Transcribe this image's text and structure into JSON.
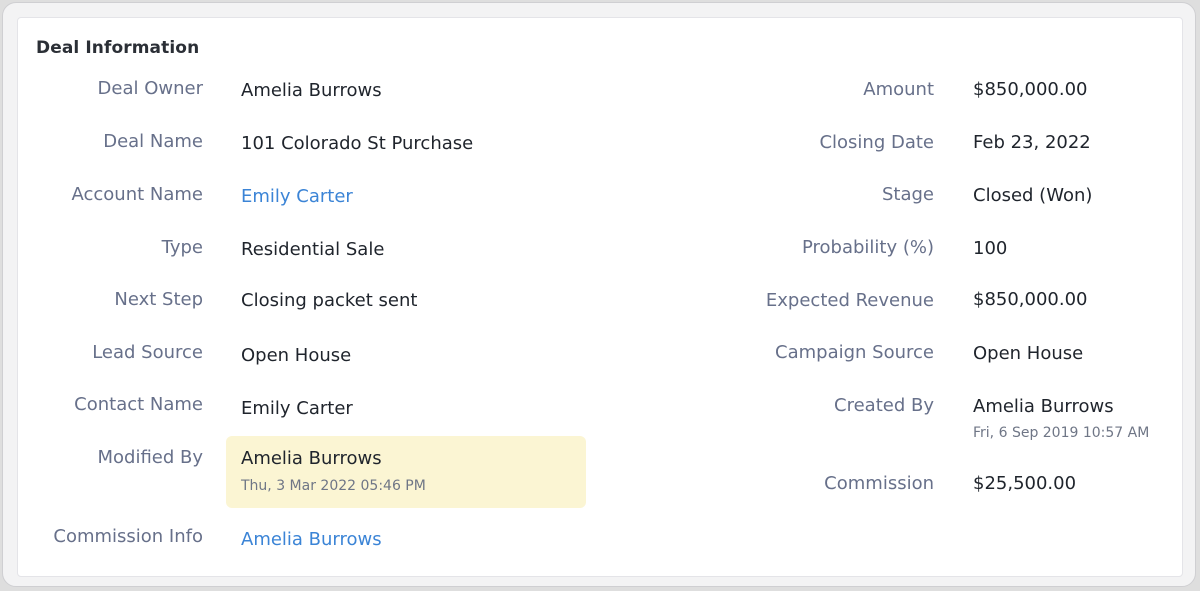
{
  "section": {
    "title": "Deal Information"
  },
  "left_fields": [
    {
      "label": "Deal Owner",
      "value": "Amelia Burrows"
    },
    {
      "label": "Deal Name",
      "value": "101 Colorado St Purchase"
    },
    {
      "label": "Account Name",
      "value": "Emily Carter"
    },
    {
      "label": "Type",
      "value": "Residential Sale"
    },
    {
      "label": "Next Step",
      "value": "Closing packet sent"
    },
    {
      "label": "Lead Source",
      "value": "Open House"
    },
    {
      "label": "Contact Name",
      "value": "Emily Carter"
    },
    {
      "label": "Modified By",
      "value": "Amelia Burrows",
      "sub": "Thu, 3 Mar 2022 05:46 PM"
    },
    {
      "label": "Commission Info",
      "value": "Amelia Burrows"
    }
  ],
  "right_fields": [
    {
      "label": "Amount",
      "value": "$850,000.00"
    },
    {
      "label": "Closing Date",
      "value": "Feb 23, 2022"
    },
    {
      "label": "Stage",
      "value": "Closed (Won)"
    },
    {
      "label": "Probability (%)",
      "value": "100"
    },
    {
      "label": "Expected Revenue",
      "value": "$850,000.00"
    },
    {
      "label": "Campaign Source",
      "value": "Open House"
    },
    {
      "label": "Created By",
      "value": "Amelia Burrows",
      "sub": "Fri, 6 Sep 2019 10:57 AM"
    },
    {
      "label": "Commission",
      "value": "$25,500.00"
    }
  ],
  "colors": {
    "link": "#3b84d6",
    "highlight": "#fbf5d3"
  }
}
